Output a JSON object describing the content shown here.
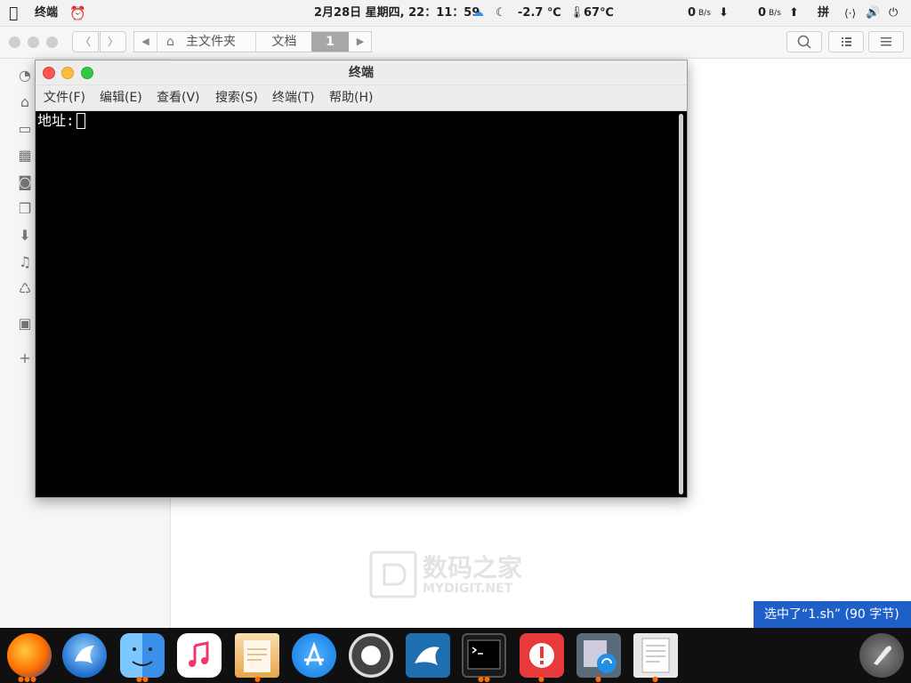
{
  "topbar": {
    "app_name": "终端",
    "datetime": "2月28日 星期四, 22：11：59",
    "temperature": "-2.7 ℃",
    "cpu_temp": "67℃",
    "net_down_value": "0",
    "net_down_unit": "B/s",
    "net_up_value": "0",
    "net_up_unit": "B/s",
    "input_method": "拼"
  },
  "file_manager": {
    "breadcrumb": [
      "主文件夹",
      "文档",
      "1"
    ]
  },
  "terminal": {
    "title": "终端",
    "menu": [
      "文件(F)",
      "编辑(E)",
      "查看(V)",
      "搜索(S)",
      "终端(T)",
      "帮助(H)"
    ],
    "prompt_text": "地址:"
  },
  "watermark": {
    "title": "数码之家",
    "subtitle": "MYDIGIT.NET"
  },
  "notification": "选中了“1.sh” (90 字节)",
  "colors": {
    "notice_bg": "#1e5fc8",
    "close": "#fc5753",
    "minimize": "#fdbc40",
    "maximize": "#33c748"
  }
}
